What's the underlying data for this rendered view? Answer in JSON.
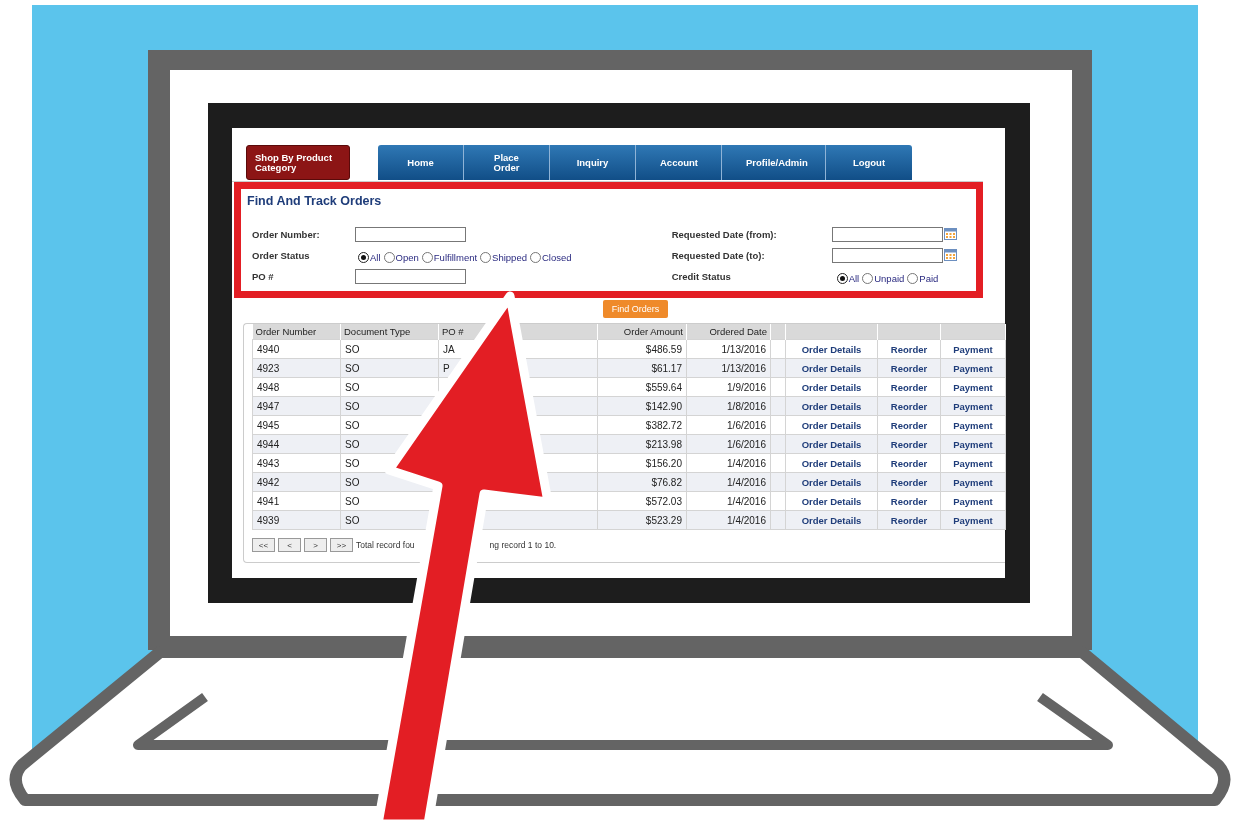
{
  "nav": {
    "category_button": "Shop By Product Category",
    "tabs": [
      {
        "label": "Home"
      },
      {
        "label": "Place Order"
      },
      {
        "label": "Inquiry"
      },
      {
        "label": "Account"
      },
      {
        "label": "Profile/Admin"
      },
      {
        "label": "Logout"
      }
    ]
  },
  "search": {
    "title": "Find And Track Orders",
    "left_fields": [
      {
        "kind": "text",
        "label": "Order Number:"
      },
      {
        "kind": "radio",
        "label": "Order Status",
        "options": [
          {
            "label": "All",
            "selected": true
          },
          {
            "label": "Open",
            "selected": false
          },
          {
            "label": "Fulfillment",
            "selected": false
          },
          {
            "label": "Shipped",
            "selected": false
          },
          {
            "label": "Closed",
            "selected": false
          }
        ]
      },
      {
        "kind": "text",
        "label": "PO #"
      }
    ],
    "right_fields": [
      {
        "kind": "date",
        "label": "Requested Date (from):"
      },
      {
        "kind": "date",
        "label": "Requested Date (to):"
      },
      {
        "kind": "radio",
        "label": "Credit Status",
        "options": [
          {
            "label": "All",
            "selected": true
          },
          {
            "label": "Unpaid",
            "selected": false
          },
          {
            "label": "Paid",
            "selected": false
          }
        ]
      }
    ],
    "find_button": "Find Orders"
  },
  "table": {
    "columns": [
      "Order Number",
      "Document Type",
      "PO #",
      "Order Amount",
      "Ordered Date"
    ],
    "rows": [
      {
        "order_number": "4940",
        "document_type": "SO",
        "po": "JA",
        "amount": "$486.59",
        "date": "1/13/2016",
        "links": [
          "Order Details",
          "Reorder",
          "Payment"
        ]
      },
      {
        "order_number": "4923",
        "document_type": "SO",
        "po": "P",
        "amount": "$61.17",
        "date": "1/13/2016",
        "links": [
          "Order Details",
          "Reorder",
          "Payment"
        ]
      },
      {
        "order_number": "4948",
        "document_type": "SO",
        "amount": "$559.64",
        "date": "1/9/2016",
        "links": [
          "Order Details",
          "Reorder",
          "Payment"
        ]
      },
      {
        "order_number": "4947",
        "document_type": "SO",
        "amount": "$142.90",
        "date": "1/8/2016",
        "links": [
          "Order Details",
          "Reorder",
          "Payment"
        ]
      },
      {
        "order_number": "4945",
        "document_type": "SO",
        "amount": "$382.72",
        "date": "1/6/2016",
        "links": [
          "Order Details",
          "Reorder",
          "Payment"
        ]
      },
      {
        "order_number": "4944",
        "document_type": "SO",
        "amount": "$213.98",
        "date": "1/6/2016",
        "links": [
          "Order Details",
          "Reorder",
          "Payment"
        ]
      },
      {
        "order_number": "4943",
        "document_type": "SO",
        "amount": "$156.20",
        "date": "1/4/2016",
        "links": [
          "Order Details",
          "Reorder",
          "Payment"
        ]
      },
      {
        "order_number": "4942",
        "document_type": "SO",
        "amount": "$76.82",
        "date": "1/4/2016",
        "links": [
          "Order Details",
          "Reorder",
          "Payment"
        ]
      },
      {
        "order_number": "4941",
        "document_type": "SO",
        "amount": "$572.03",
        "date": "1/4/2016",
        "links": [
          "Order Details",
          "Reorder",
          "Payment"
        ]
      },
      {
        "order_number": "4939",
        "document_type": "SO",
        "amount": "$523.29",
        "date": "1/4/2016",
        "links": [
          "Order Details",
          "Reorder",
          "Payment"
        ]
      }
    ]
  },
  "pagination": {
    "buttons": [
      "<<",
      "<",
      ">",
      ">>"
    ],
    "texts": [
      "Total record fou",
      "ng record 1 to 10."
    ]
  }
}
